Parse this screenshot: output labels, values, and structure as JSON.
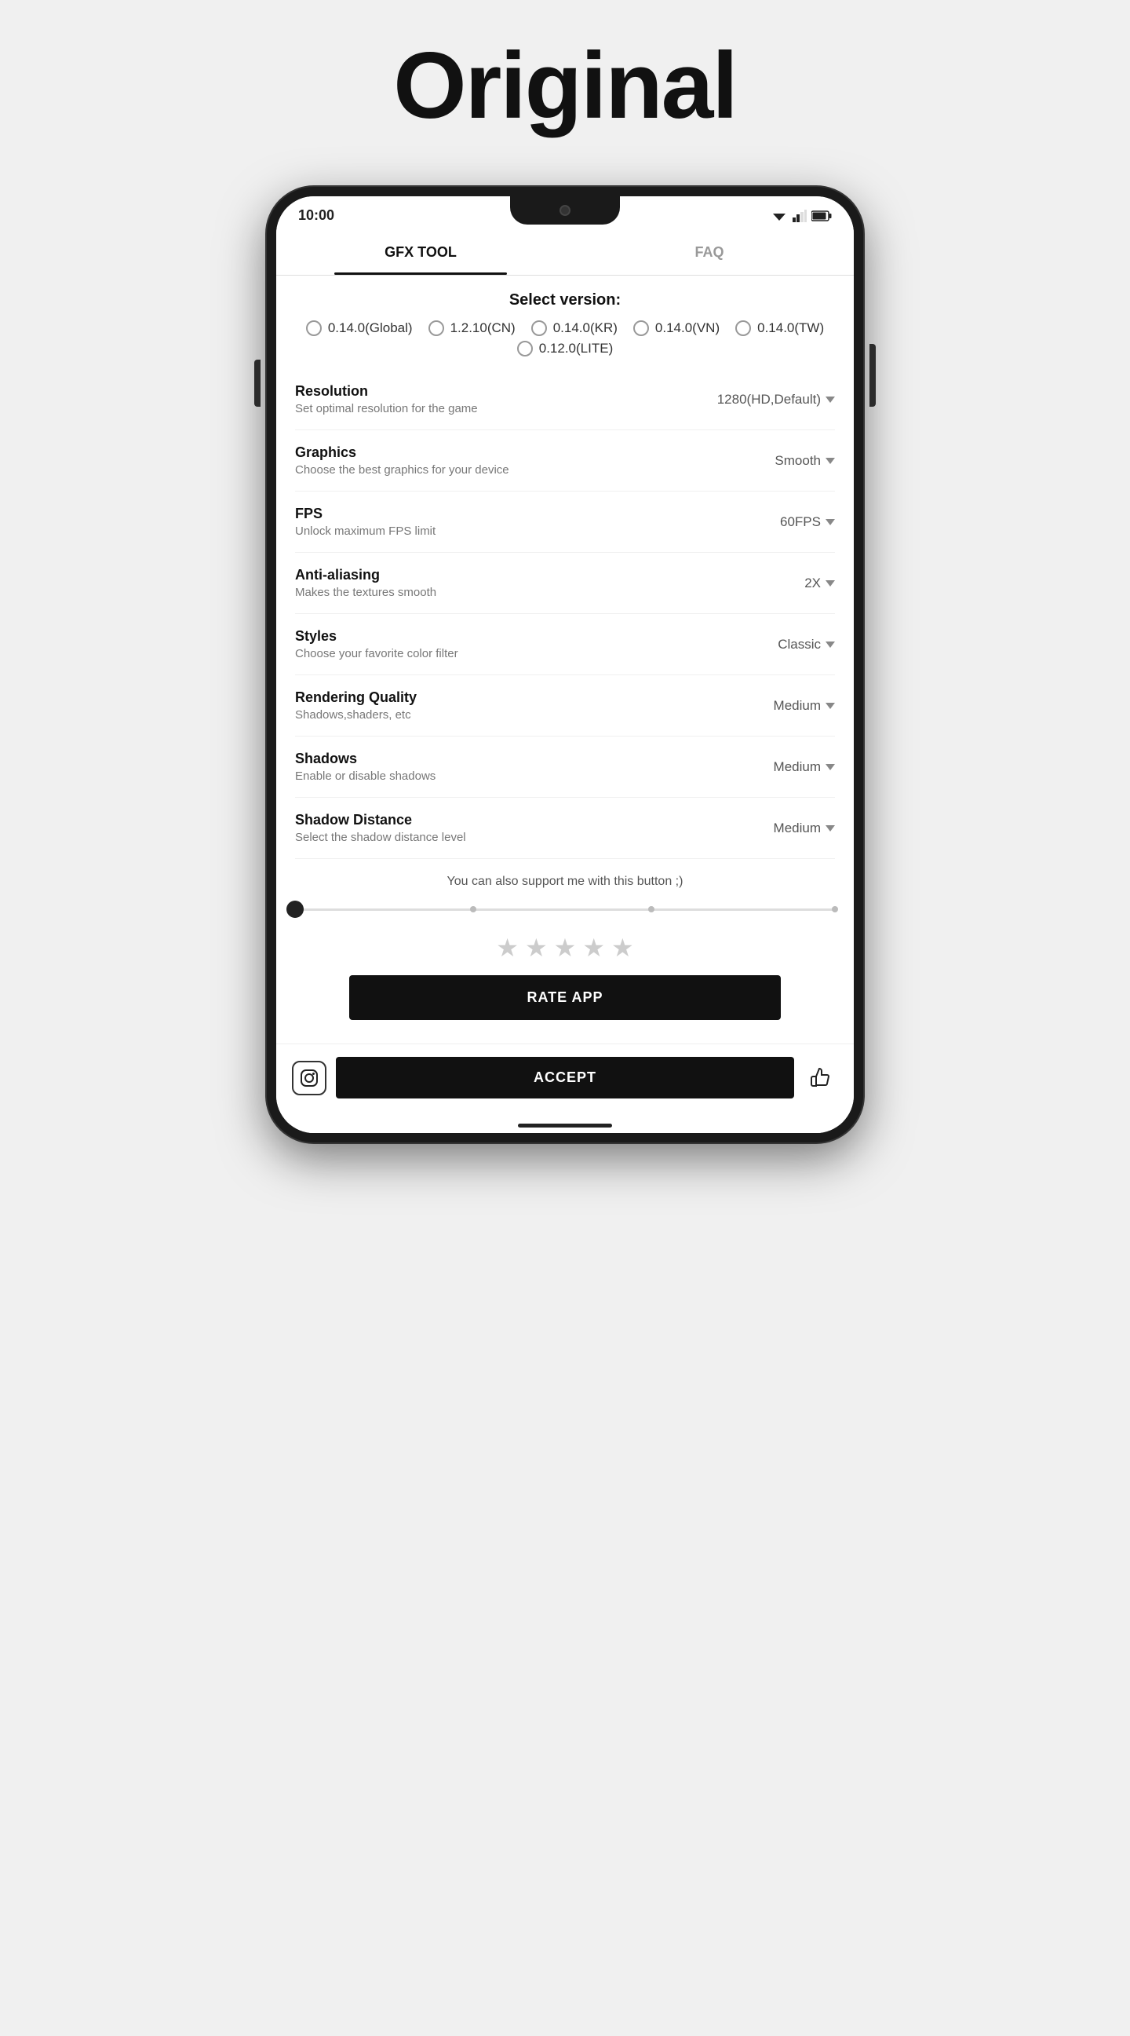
{
  "header": {
    "title": "Original"
  },
  "statusBar": {
    "time": "10:00"
  },
  "tabs": [
    {
      "label": "GFX TOOL",
      "active": true
    },
    {
      "label": "FAQ",
      "active": false
    }
  ],
  "versionSection": {
    "title": "Select version:",
    "options": [
      {
        "label": "0.14.0(Global)",
        "selected": false
      },
      {
        "label": "1.2.10(CN)",
        "selected": false
      },
      {
        "label": "0.14.0(KR)",
        "selected": false
      },
      {
        "label": "0.14.0(VN)",
        "selected": false
      },
      {
        "label": "0.14.0(TW)",
        "selected": false
      },
      {
        "label": "0.12.0(LITE)",
        "selected": false
      }
    ]
  },
  "settings": [
    {
      "label": "Resolution",
      "desc": "Set optimal resolution for the game",
      "value": "1280(HD,Default)"
    },
    {
      "label": "Graphics",
      "desc": "Choose the best graphics for your device",
      "value": "Smooth"
    },
    {
      "label": "FPS",
      "desc": "Unlock maximum FPS limit",
      "value": "60FPS"
    },
    {
      "label": "Anti-aliasing",
      "desc": "Makes the textures smooth",
      "value": "2X"
    },
    {
      "label": "Styles",
      "desc": "Choose your favorite color filter",
      "value": "Classic"
    },
    {
      "label": "Rendering Quality",
      "desc": "Shadows,shaders, etc",
      "value": "Medium"
    },
    {
      "label": "Shadows",
      "desc": "Enable or disable shadows",
      "value": "Medium"
    },
    {
      "label": "Shadow Distance",
      "desc": "Select the shadow distance level",
      "value": "Medium"
    }
  ],
  "supportText": "You can also support me with this button ;)",
  "rateButton": "RATE APP",
  "acceptButton": "ACCEPT"
}
